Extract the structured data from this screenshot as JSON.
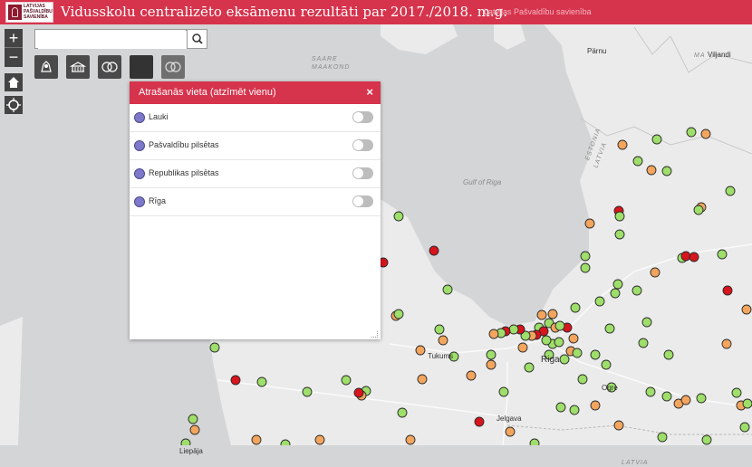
{
  "header": {
    "logo_text": "LATVIJAS\nPAŠVALDĪBU\nSAVIENĪBA",
    "title": "Vidusskolu centralizēto eksāmenu rezultāti par 2017./2018. m.g.",
    "org": "Latvijas Pašvaldību savienība"
  },
  "search": {
    "placeholder": ""
  },
  "map_controls": {
    "zoom_in": "+",
    "zoom_out": "−"
  },
  "panel": {
    "title": "Atrašanās vieta (atzīmēt vienu)",
    "close": "×",
    "items": [
      {
        "label": "Lauki",
        "checked": false
      },
      {
        "label": "Pašvaldību pilsētas",
        "checked": false
      },
      {
        "label": "Republikas pilsētas",
        "checked": false
      },
      {
        "label": "Rīga",
        "checked": false
      }
    ]
  },
  "map_labels": {
    "saare": "SAARE\nMAAKOND",
    "parnu": "Pärnu",
    "viljandi": "Viljandi",
    "estonia": "ESTONIA",
    "latvia": "LATVIA",
    "gulf": "Gulf of Riga",
    "riga": "Riga",
    "tukums": "Tukums",
    "jelgava": "Jelgava",
    "liepaja": "Liepāja",
    "ogre": "Ogre",
    "latvia_bottom": "LATVIA",
    "ma": "MA"
  },
  "colors": {
    "header": "#d6334c",
    "green": "#9ede6a",
    "orange": "#f3a55e",
    "red": "#d8141c",
    "purple": "#7d78c9"
  }
}
